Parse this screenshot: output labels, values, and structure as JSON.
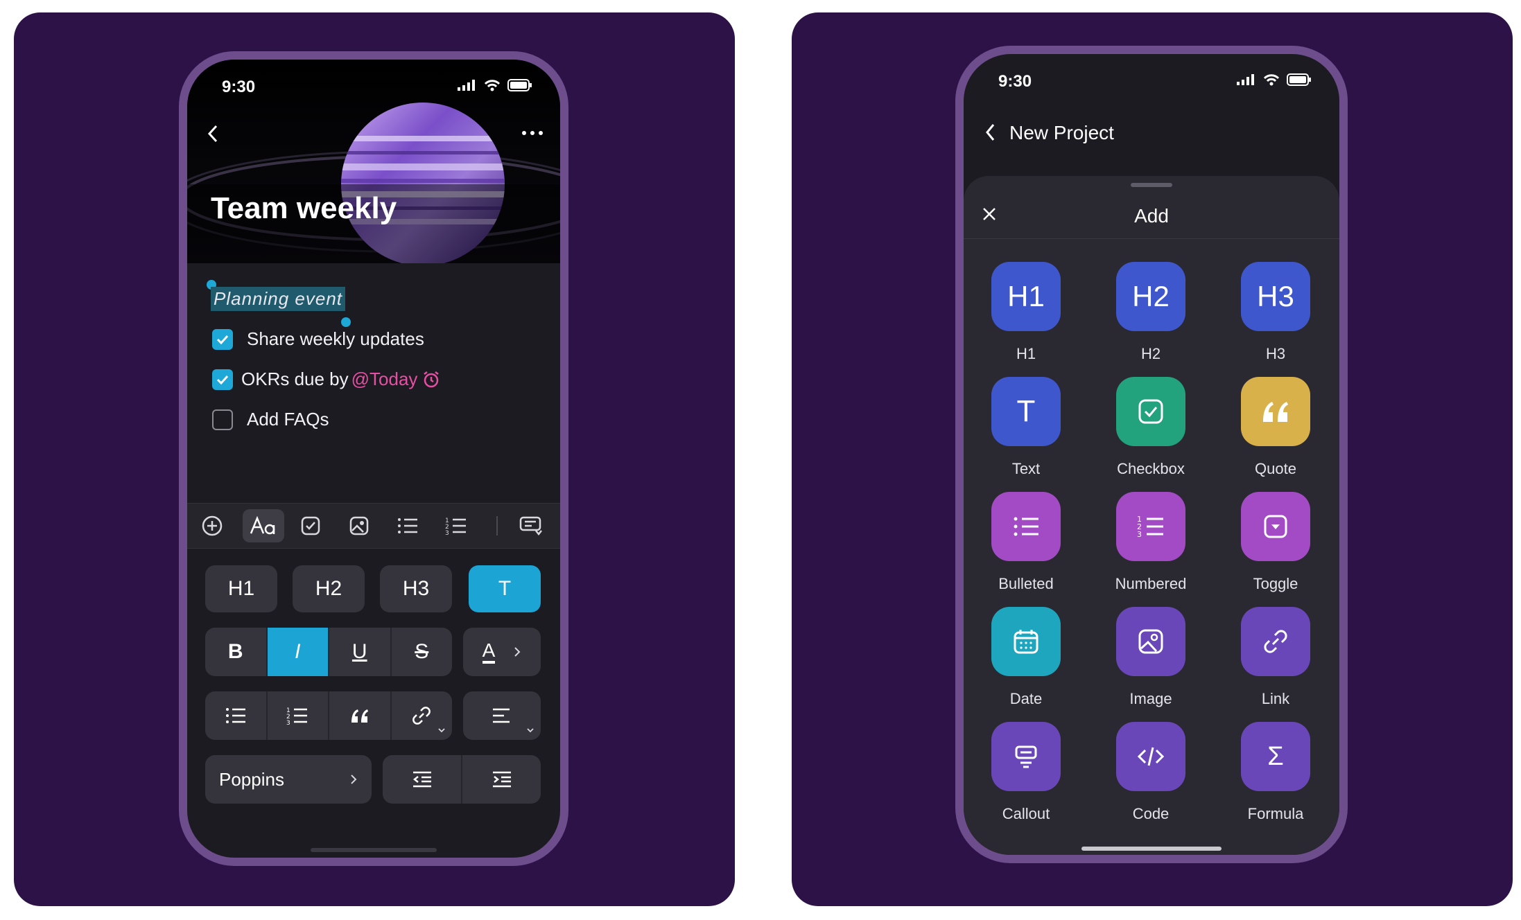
{
  "left_phone": {
    "status_time": "9:30",
    "title": "Team weekly",
    "selected_text": "Planning event",
    "todos": [
      {
        "text": "Share weekly updates",
        "checked": true
      },
      {
        "text": "OKRs due by ",
        "mention": "@Today",
        "checked": true
      },
      {
        "text": "Add FAQs",
        "checked": false
      }
    ],
    "toolbar_icons": [
      "plus-circle-icon",
      "text-style-icon",
      "checkbox-icon",
      "image-icon",
      "bullet-list-icon",
      "numbered-list-icon",
      "keyboard-dismiss-icon"
    ],
    "heading_buttons": [
      "H1",
      "H2",
      "H3",
      "T"
    ],
    "format_buttons": [
      "B",
      "I",
      "U",
      "S"
    ],
    "text_color_button": "A",
    "font_name": "Poppins",
    "colors": {
      "accent": "#1ba4d4",
      "mention": "#e84fa4",
      "panel": "#2d1247",
      "frame": "#6e4d8d"
    }
  },
  "right_phone": {
    "status_time": "9:30",
    "nav_title": "New Project",
    "sheet_title": "Add",
    "tiles": [
      {
        "label": "H1",
        "glyph": "H1",
        "color": "#3f57cc"
      },
      {
        "label": "H2",
        "glyph": "H2",
        "color": "#3f57cc"
      },
      {
        "label": "H3",
        "glyph": "H3",
        "color": "#3f57cc"
      },
      {
        "label": "Text",
        "glyph": "T",
        "color": "#3f57cc"
      },
      {
        "label": "Checkbox",
        "icon": "checkbox-icon",
        "color": "#23a27e"
      },
      {
        "label": "Quote",
        "glyph": "66",
        "color": "#d9b14a"
      },
      {
        "label": "Bulleted",
        "icon": "bullet-list-icon",
        "color": "#a34bc4"
      },
      {
        "label": "Numbered",
        "icon": "numbered-list-icon",
        "color": "#a34bc4"
      },
      {
        "label": "Toggle",
        "icon": "toggle-icon",
        "color": "#a34bc4"
      },
      {
        "label": "Date",
        "icon": "calendar-icon",
        "color": "#1fa6bf"
      },
      {
        "label": "Image",
        "icon": "image-icon",
        "color": "#6a47b8"
      },
      {
        "label": "Link",
        "icon": "link-icon",
        "color": "#6a47b8"
      },
      {
        "label": "Callout",
        "icon": "callout-icon",
        "color": "#6a47b8"
      },
      {
        "label": "Code",
        "icon": "code-icon",
        "color": "#6a47b8"
      },
      {
        "label": "Formula",
        "glyph": "Σ",
        "color": "#6a47b8"
      }
    ]
  }
}
